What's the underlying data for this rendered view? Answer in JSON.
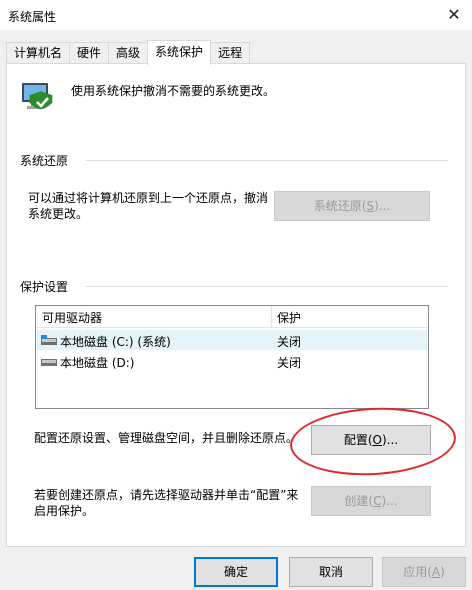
{
  "window": {
    "title": "系统属性",
    "close_glyph": "✕"
  },
  "tabs": [
    {
      "label": "计算机名"
    },
    {
      "label": "硬件"
    },
    {
      "label": "高级"
    },
    {
      "label": "系统保护",
      "active": true
    },
    {
      "label": "远程"
    }
  ],
  "intro": {
    "text": "使用系统保护撤消不需要的系统更改。",
    "icon": "system-protection-icon"
  },
  "restore": {
    "section_title": "系统还原",
    "description_line1": "可以通过将计算机还原到上一个还原点，撤消",
    "description_line2": "系统更改。",
    "button_label_prefix": "系统还原(",
    "button_label_key": "S",
    "button_label_suffix": ")..."
  },
  "protection": {
    "section_title": "保护设置",
    "columns": [
      "可用驱动器",
      "保护"
    ],
    "drives": [
      {
        "name": "本地磁盘 (C:) (系统)",
        "status": "关闭",
        "icon": "system-drive-icon"
      },
      {
        "name": "本地磁盘 (D:)",
        "status": "关闭",
        "icon": "drive-icon"
      }
    ],
    "configure_text": "配置还原设置、管理磁盘空间，并且删除还原点。",
    "configure_prefix": "配置(",
    "configure_key": "O",
    "configure_suffix": ")...",
    "create_line1": "若要创建还原点，请先选择驱动器并单击“配置”来",
    "create_line2": "启用保护。",
    "create_prefix": "创建(",
    "create_key": "C",
    "create_suffix": ")..."
  },
  "footer": {
    "ok": "确定",
    "cancel": "取消",
    "apply_prefix": "应用(",
    "apply_key": "A",
    "apply_suffix": ")"
  },
  "colors": {
    "accent": "#0078d7",
    "annotation": "#e0282e",
    "row_highlight": "#e5f3fb"
  }
}
